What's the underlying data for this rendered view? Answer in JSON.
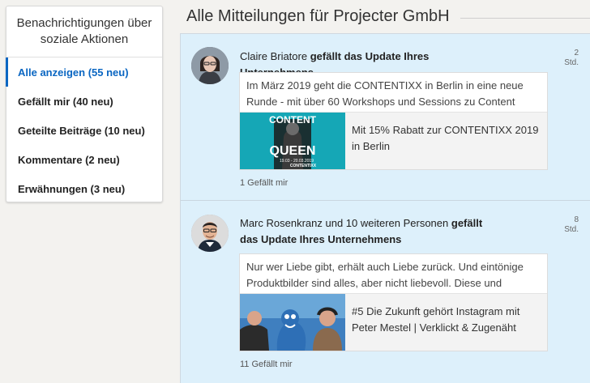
{
  "sidebar": {
    "title": "Benachrichtigungen über soziale Aktionen",
    "items": [
      {
        "label": "Alle anzeigen (55 neu)"
      },
      {
        "label": "Gefällt mir (40 neu)"
      },
      {
        "label": "Geteilte Beiträge (10 neu)"
      },
      {
        "label": "Kommentare (2 neu)"
      },
      {
        "label": "Erwähnungen (3 neu)"
      }
    ]
  },
  "main": {
    "title": "Alle Mitteilungen für Projecter GmbH",
    "notifications": [
      {
        "actor": "Claire Briatore",
        "action": "gefällt das Update Ihres Unternehmens",
        "time_value": "2",
        "time_unit": "Std.",
        "post_text": "Im März 2019 geht die CONTENTIXX in Berlin in eine neue Runde - mit über 60 Workshops und Sessions zu Content",
        "link_title": "Mit 15% Rabatt zur CONTENTIXX 2019 in Berlin",
        "thumb": {
          "line1": "CONTENT",
          "line2": "QUEEN",
          "date": "19.03 - 20.03.2019",
          "brand": "CONTENTIXX"
        },
        "likes": "1 Gefällt mir"
      },
      {
        "actor": "Marc Rosenkranz und 10 weiteren Personen",
        "action": "gefällt das Update Ihres Unternehmens",
        "time_value": "8",
        "time_unit": "Std.",
        "post_text": "Nur wer Liebe gibt, erhält auch Liebe zurück. Und eintönige Produktbilder sind alles, aber nicht liebevoll. Diese und",
        "link_title": "#5 Die Zukunft gehört Instagram mit Peter Mestel | Verklickt & Zugenäht",
        "likes": "11 Gefällt mir"
      }
    ]
  },
  "colors": {
    "accent": "#0a66c2",
    "card_bg": "#ddf0fb"
  }
}
